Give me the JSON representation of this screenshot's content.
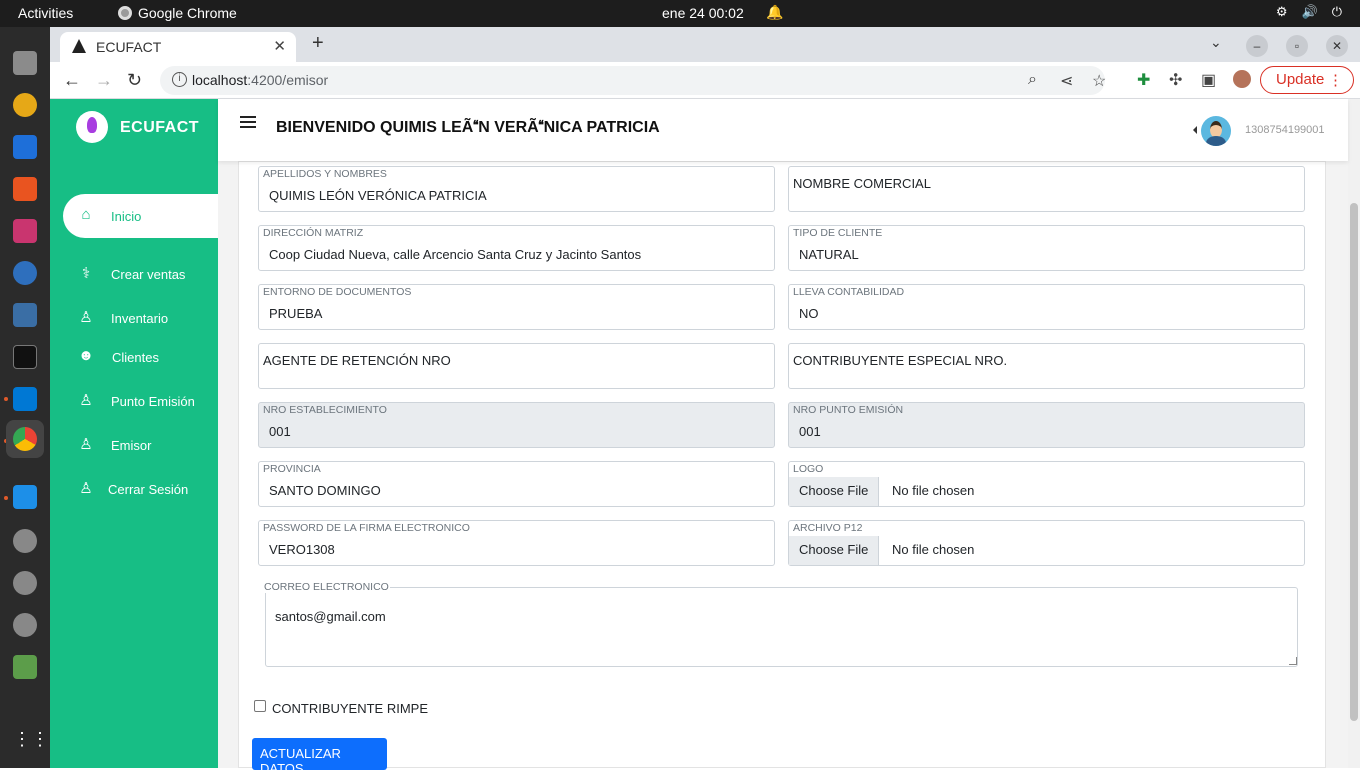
{
  "system": {
    "activities": "Activities",
    "app_name": "Google Chrome",
    "clock": "ene 24  00:02"
  },
  "browser": {
    "tab_title": "ECUFACT",
    "url_host": "localhost",
    "url_path": ":4200/emisor",
    "update_label": "Update"
  },
  "sidebar": {
    "brand": "ECUFACT",
    "items": [
      {
        "label": "Inicio",
        "icon": "home-icon"
      },
      {
        "label": "Crear ventas",
        "icon": "stethoscope-icon"
      },
      {
        "label": "Inventario",
        "icon": "user-icon"
      },
      {
        "label": "Clientes",
        "icon": "users-icon"
      },
      {
        "label": "Punto Emisión",
        "icon": "user-tie-icon"
      },
      {
        "label": "Emisor",
        "icon": "user-icon"
      },
      {
        "label": "Cerrar Sesión",
        "icon": "user-tie-icon"
      }
    ]
  },
  "header": {
    "welcome": "BIENVENIDO QUIMIS LEÃN VERÃNICA PATRICIA",
    "user_id": "1308754199001"
  },
  "form": {
    "apellidos": {
      "label": "APELLIDOS Y NOMBRES",
      "value": "QUIMIS LEÓN VERÓNICA PATRICIA"
    },
    "nombre_comercial": {
      "placeholder": "NOMBRE COMERCIAL"
    },
    "direccion": {
      "label": "DIRECCIÓN MATRIZ",
      "value": "Coop Ciudad Nueva, calle Arcencio Santa Cruz y Jacinto Santos"
    },
    "tipo_cliente": {
      "label": "TIPO DE CLIENTE",
      "value": "NATURAL"
    },
    "entorno": {
      "label": "ENTORNO DE DOCUMENTOS",
      "value": "PRUEBA"
    },
    "contabilidad": {
      "label": "LLEVA CONTABILIDAD",
      "value": "NO"
    },
    "agente_retencion": {
      "placeholder": "AGENTE DE RETENCIÓN NRO"
    },
    "contribuyente_especial": {
      "placeholder": "CONTRIBUYENTE ESPECIAL NRO."
    },
    "establecimiento": {
      "label": "NRO ESTABLECIMIENTO",
      "value": "001"
    },
    "punto_emision": {
      "label": "NRO PUNTO EMISIÓN",
      "value": "001"
    },
    "provincia": {
      "label": "PROVINCIA",
      "value": "SANTO DOMINGO"
    },
    "logo": {
      "label": "LOGO",
      "button": "Choose File",
      "status": "No file chosen"
    },
    "password_firma": {
      "label": "PASSWORD DE LA FIRMA ELECTRONICO",
      "value": "VERO1308"
    },
    "archivo_p12": {
      "label": "ARCHIVO P12",
      "button": "Choose File",
      "status": "No file chosen"
    },
    "correo": {
      "label": "CORREO ELECTRONICO",
      "value": "santos@gmail.com"
    },
    "rimpe": {
      "label": "CONTRIBUYENTE RIMPE",
      "checked": false
    },
    "submit": "ACTUALIZAR DATOS"
  },
  "colors": {
    "sidebar": "#17be85",
    "primary_button": "#0d6efd",
    "update": "#d93025"
  }
}
